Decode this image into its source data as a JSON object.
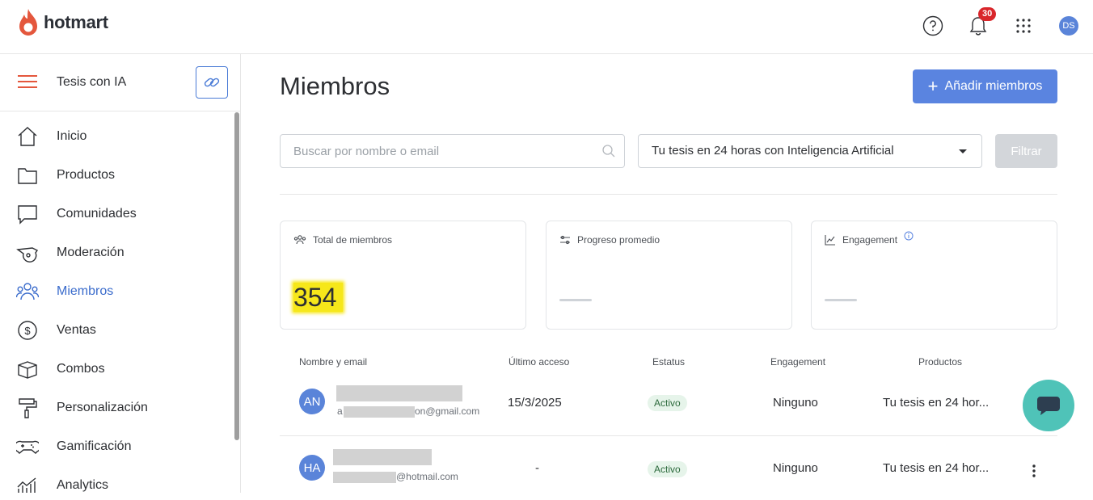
{
  "app": {
    "brand": "hotmart",
    "brand_color": "#e4573d",
    "accent_color": "#5a84e0"
  },
  "topbar": {
    "help_icon": "question-circle-icon",
    "notifications_icon": "bell-icon",
    "notifications_count": "30",
    "apps_icon": "grid-dots-icon",
    "user_initials": "DS"
  },
  "sidebar": {
    "club_name": "Tesis con IA",
    "items": [
      {
        "label": "Inicio",
        "icon": "home-icon"
      },
      {
        "label": "Productos",
        "icon": "folder-icon"
      },
      {
        "label": "Comunidades",
        "icon": "chat-bubble-icon"
      },
      {
        "label": "Moderación",
        "icon": "whistle-icon"
      },
      {
        "label": "Miembros",
        "icon": "users-icon",
        "active": true
      },
      {
        "label": "Ventas",
        "icon": "dollar-circle-icon"
      },
      {
        "label": "Combos",
        "icon": "box-icon"
      },
      {
        "label": "Personalización",
        "icon": "paint-roller-icon"
      },
      {
        "label": "Gamificación",
        "icon": "gamepad-icon"
      },
      {
        "label": "Analytics",
        "icon": "chart-icon"
      }
    ]
  },
  "main": {
    "title": "Miembros",
    "add_button": "Añadir miembros",
    "search_placeholder": "Buscar por nombre o email",
    "product_select": "Tu tesis en 24 horas con Inteligencia Artificial",
    "filter_button": "Filtrar",
    "cards": [
      {
        "label": "Total de miembros",
        "value": "354",
        "icon": "users-small-icon"
      },
      {
        "label": "Progreso promedio",
        "icon": "progress-icon"
      },
      {
        "label": "Engagement",
        "icon": "trend-chart-icon"
      }
    ],
    "table": {
      "columns": [
        "Nombre y email",
        "Último acceso",
        "Estatus",
        "Engagement",
        "Productos"
      ],
      "rows": [
        {
          "initials": "AN",
          "email_prefix": "a",
          "email_suffix": "on@gmail.com",
          "last_access": "15/3/2025",
          "status": "Activo",
          "engagement": "Ninguno",
          "product": "Tu tesis en 24 hor..."
        },
        {
          "initials": "HA",
          "email_suffix": "@hotmail.com",
          "last_access": "-",
          "status": "Activo",
          "engagement": "Ninguno",
          "product": "Tu tesis en 24 hor..."
        }
      ]
    }
  },
  "chat_icon": "chat-support-icon"
}
